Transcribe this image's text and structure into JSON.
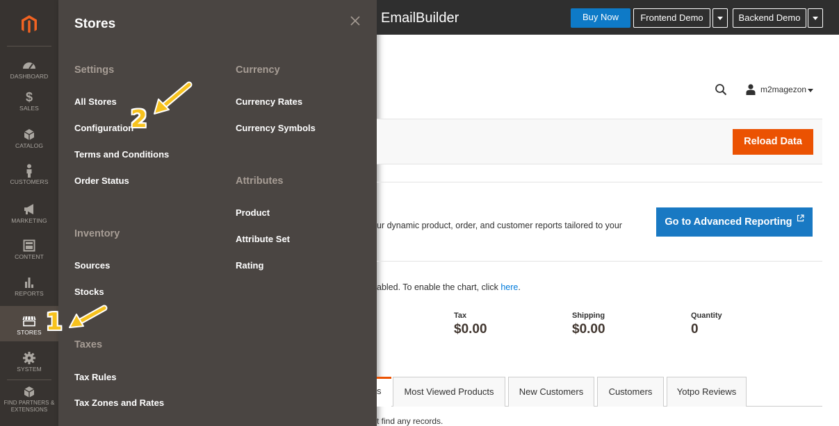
{
  "nav": {
    "items": [
      {
        "label": "Dashboard",
        "icon": "dashboard-icon"
      },
      {
        "label": "Sales",
        "icon": "dollar-icon"
      },
      {
        "label": "Catalog",
        "icon": "box-icon"
      },
      {
        "label": "Customers",
        "icon": "person-icon"
      },
      {
        "label": "Marketing",
        "icon": "megaphone-icon"
      },
      {
        "label": "Content",
        "icon": "layout-icon"
      },
      {
        "label": "Reports",
        "icon": "bar-chart-icon"
      },
      {
        "label": "Stores",
        "icon": "storefront-icon"
      },
      {
        "label": "System",
        "icon": "gear-icon"
      },
      {
        "label": "Find Partners & Extensions",
        "icon": "extensions-icon"
      }
    ],
    "active": "Stores"
  },
  "flyout": {
    "title": "Stores",
    "settings": {
      "header": "Settings",
      "links": [
        "All Stores",
        "Configuration",
        "Terms and Conditions",
        "Order Status"
      ]
    },
    "inventory": {
      "header": "Inventory",
      "links": [
        "Sources",
        "Stocks"
      ]
    },
    "taxes": {
      "header": "Taxes",
      "links": [
        "Tax Rules",
        "Tax Zones and Rates"
      ]
    },
    "currency": {
      "header": "Currency",
      "links": [
        "Currency Rates",
        "Currency Symbols"
      ]
    },
    "attributes": {
      "header": "Attributes",
      "links": [
        "Product",
        "Attribute Set",
        "Rating"
      ]
    }
  },
  "topbar": {
    "app_title": "EmailBuilder",
    "buy_now": "Buy Now",
    "frontend_demo": "Frontend Demo",
    "backend_demo": "Backend Demo"
  },
  "header": {
    "username": "m2magezon"
  },
  "dashboard": {
    "reload_label": "Reload Data",
    "advanced_text": "ur dynamic product, order, and customer reports tailored to your",
    "advanced_button": "Go to Advanced Reporting",
    "chart_msg_prefix": "abled. To enable the chart, click ",
    "chart_msg_link": "here",
    "chart_msg_suffix": ".",
    "stats": [
      {
        "label": "Tax",
        "value": "$0.00"
      },
      {
        "label": "Shipping",
        "value": "$0.00"
      },
      {
        "label": "Quantity",
        "value": "0"
      }
    ],
    "tab_partial": "s",
    "tabs": [
      "Most Viewed Products",
      "New Customers",
      "Customers",
      "Yotpo Reviews"
    ],
    "no_records": "t find any records."
  },
  "annotations": {
    "step1": "1",
    "step2": "2",
    "color": "#f7c21e"
  }
}
